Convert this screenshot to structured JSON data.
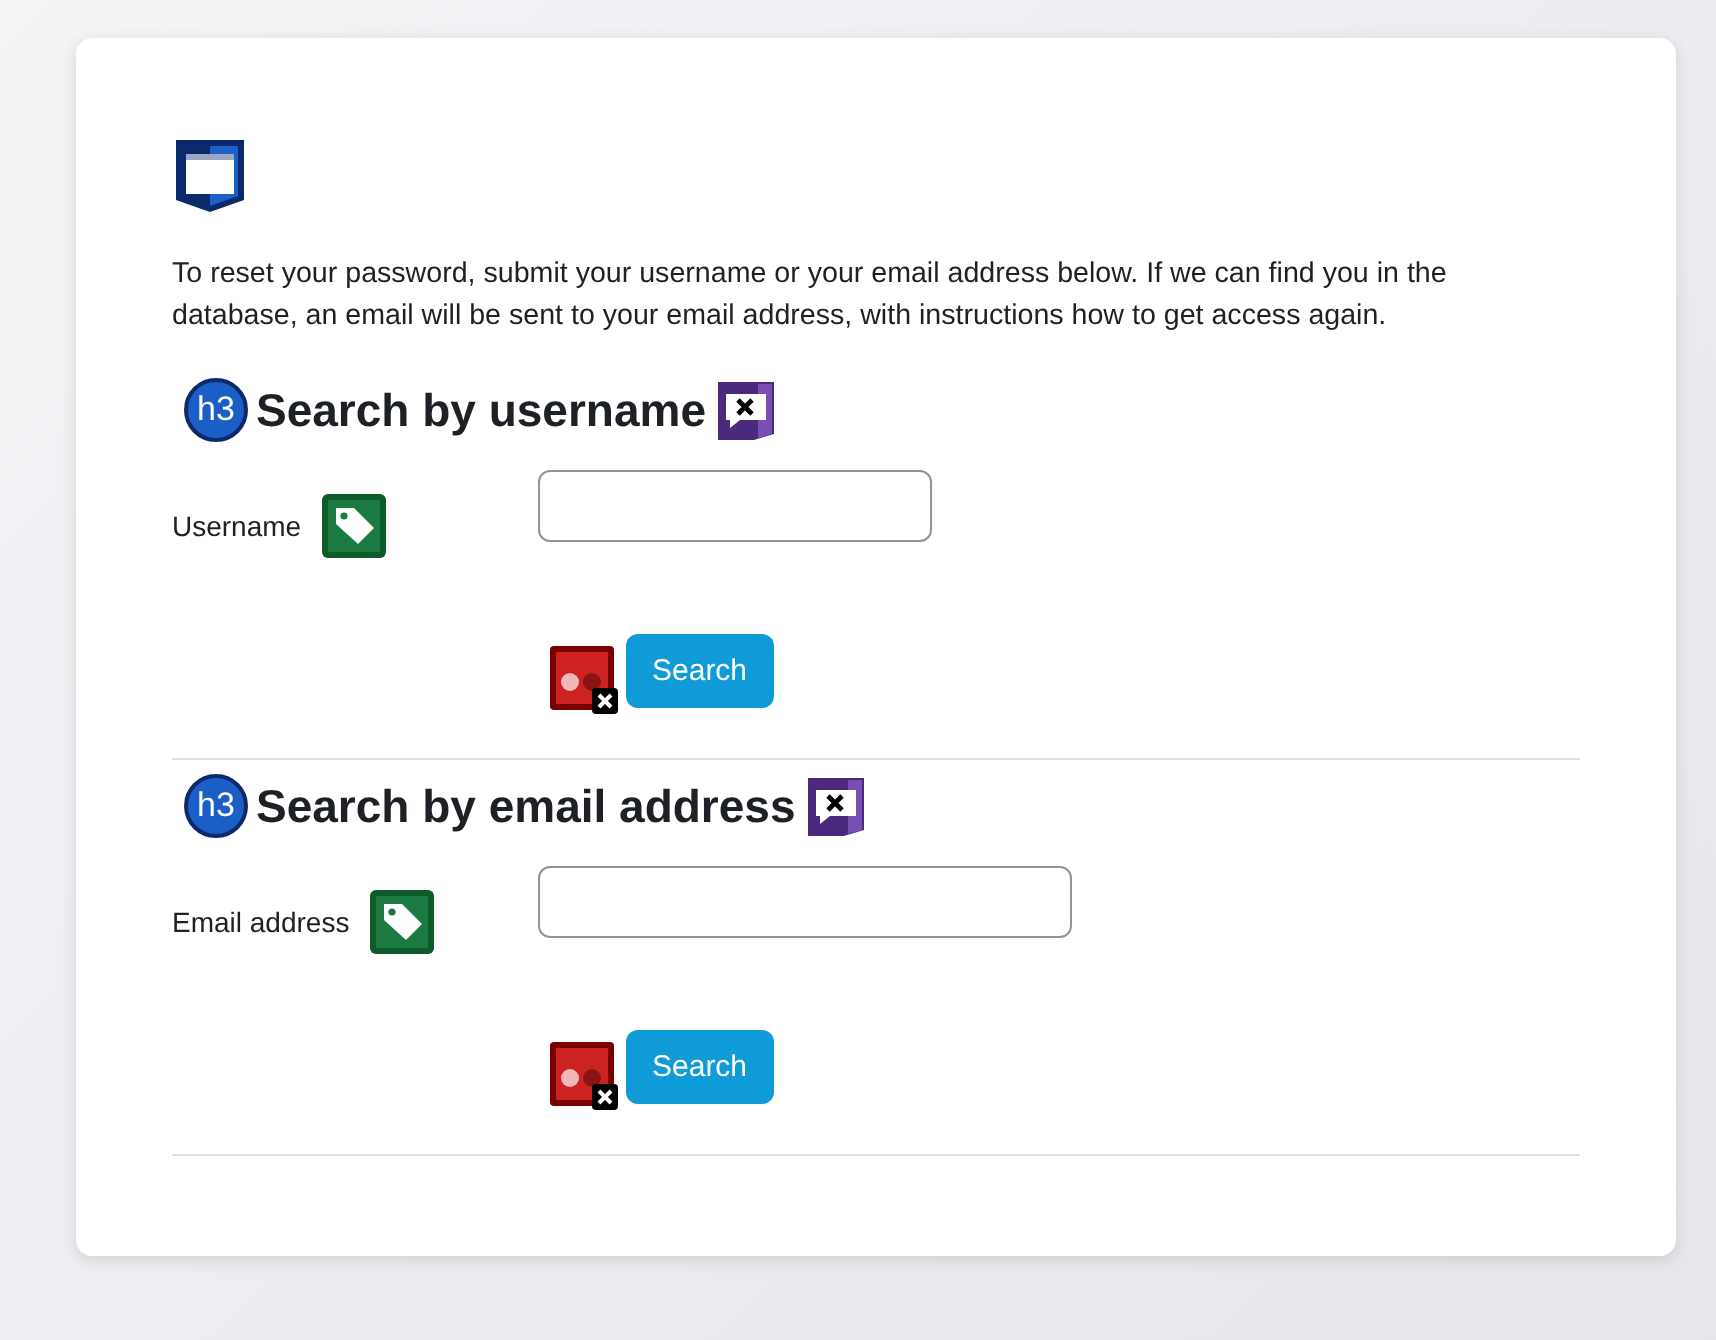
{
  "intro": "To reset your password, submit your username or your email address below. If we can find you in the database, an email will be sent to your email address, with instructions how to get access again.",
  "sections": [
    {
      "badge": "h3",
      "heading": "Search by username",
      "field_label": "Username",
      "button": "Search"
    },
    {
      "badge": "h3",
      "heading": "Search by email address",
      "field_label": "Email address",
      "button": "Search"
    }
  ]
}
